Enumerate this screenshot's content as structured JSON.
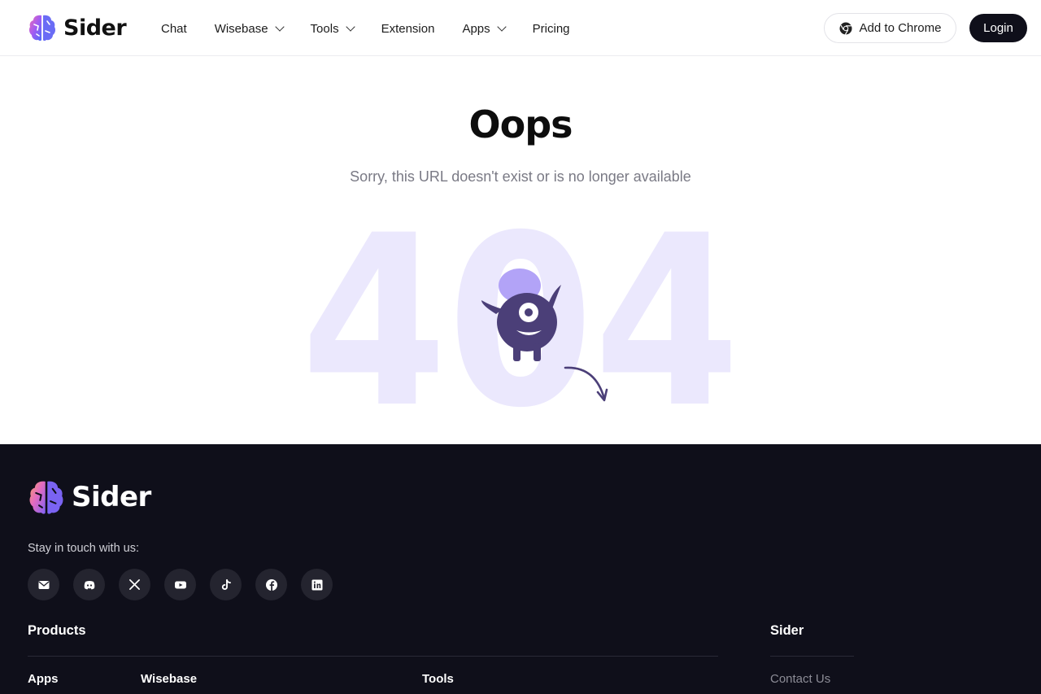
{
  "brand": {
    "name": "Sider"
  },
  "nav": {
    "chat": "Chat",
    "wisebase": "Wisebase",
    "tools": "Tools",
    "extension": "Extension",
    "apps": "Apps",
    "pricing": "Pricing"
  },
  "header": {
    "add_chrome": "Add to Chrome",
    "login": "Login",
    "chrome_icon": "chrome-icon"
  },
  "error": {
    "title": "Oops",
    "message": "Sorry, this URL doesn't exist or is no longer available",
    "code": "404",
    "illustration": "one-eyed-monster"
  },
  "footer": {
    "stay_in_touch": "Stay in touch with us:",
    "socials": [
      "mail-icon",
      "discord-icon",
      "x-icon",
      "youtube-icon",
      "tiktok-icon",
      "facebook-icon",
      "linkedin-icon"
    ],
    "products_heading": "Products",
    "sider_heading": "Sider",
    "col_apps": "Apps",
    "col_wisebase": "Wisebase",
    "col_tools": "Tools",
    "contact_us": "Contact Us"
  },
  "colors": {
    "footer_bg": "#0f0f1a",
    "accent_purple": "#4b3f78",
    "light_purple": "#ebe8fd"
  }
}
